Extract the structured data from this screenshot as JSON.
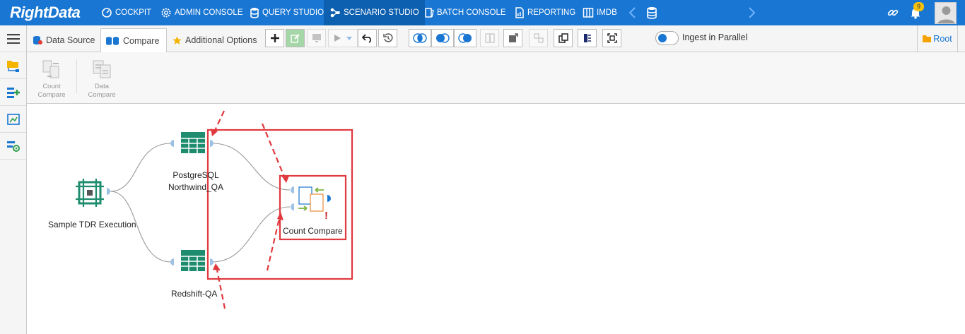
{
  "brand": {
    "name": "RightData"
  },
  "nav": [
    {
      "label": "COCKPIT",
      "icon": "cockpit-icon"
    },
    {
      "label": "ADMIN CONSOLE",
      "icon": "gear-icon"
    },
    {
      "label": "QUERY STUDIO",
      "icon": "database-icon"
    },
    {
      "label": "SCENARIO STUDIO",
      "icon": "scenario-icon",
      "active": true
    },
    {
      "label": "BATCH CONSOLE",
      "icon": "batch-icon"
    },
    {
      "label": "REPORTING",
      "icon": "report-icon"
    },
    {
      "label": "IMDB",
      "icon": "columns-icon"
    }
  ],
  "notifications": {
    "count": "9"
  },
  "tabs": [
    {
      "label": "Data Source",
      "icon": "data-source-icon"
    },
    {
      "label": "Compare",
      "icon": "compare-icon",
      "active": true
    },
    {
      "label": "Additional Options",
      "icon": "star-icon"
    }
  ],
  "toolbar": {
    "ingest_label": "Ingest in Parallel",
    "root_label": "Root"
  },
  "tools": [
    {
      "label": "Count Compare"
    },
    {
      "label": "Data Compare"
    }
  ],
  "canvas": {
    "nodes": {
      "source": {
        "label": "Sample TDR Execution"
      },
      "postgres": {
        "label_line1": "PostgreSQL",
        "label_line2": "Northwind_QA"
      },
      "redshift": {
        "label": "Redshift-QA"
      },
      "count_compare": {
        "label": "Count Compare",
        "warning": "!"
      }
    }
  },
  "colors": {
    "topbar": "#1976d2",
    "active_nav": "#0d5fb0",
    "node_green": "#1e8c6e",
    "annotation_red": "#e0393e",
    "port_blue": "#1976d2"
  }
}
